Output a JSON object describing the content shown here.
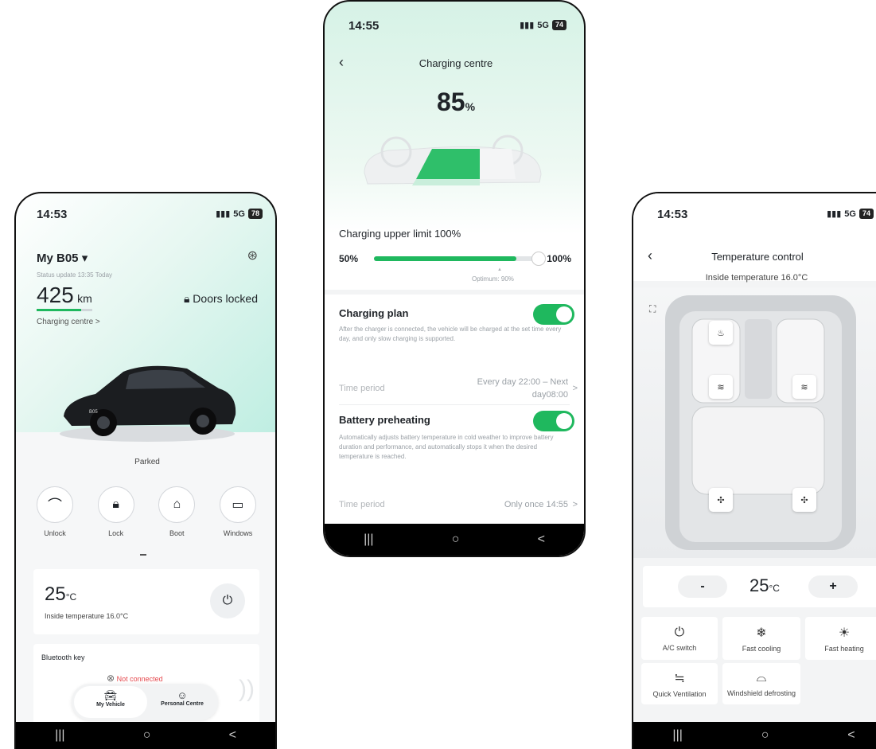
{
  "status_bars": {
    "left": {
      "time": "14:53",
      "signal": "5G",
      "battery": "78"
    },
    "center": {
      "time": "14:55",
      "signal": "5G",
      "battery": "74"
    },
    "right": {
      "time": "14:53",
      "signal": "5G",
      "battery": "74"
    }
  },
  "navbar": {
    "recent": "|||",
    "home": "○",
    "back": "<"
  },
  "vehicle": {
    "title": "My B05 ▾",
    "status_update": "Status update 13:35 Today",
    "range_value": "425",
    "range_unit": "km",
    "doors_status": "Doors locked",
    "charging_link": "Charging centre >",
    "car_state": "Parked",
    "car_badge": "B05",
    "actions": [
      {
        "label": "Unlock",
        "icon": "unlock-icon"
      },
      {
        "label": "Lock",
        "icon": "lock-icon"
      },
      {
        "label": "Boot",
        "icon": "car-boot-icon"
      },
      {
        "label": "Windows",
        "icon": "window-icon"
      }
    ],
    "climate": {
      "temp": "25",
      "unit": "°C",
      "inside": "Inside temperature 16.0°C"
    },
    "bluetooth": {
      "title": "Bluetooth key",
      "status": "Not connected"
    },
    "tabs": [
      {
        "label": "My Vehicle"
      },
      {
        "label": "Personal Centre"
      }
    ]
  },
  "charging": {
    "title": "Charging centre",
    "percent": "85",
    "percent_unit": "%",
    "upper_limit_label": "Charging upper limit 100%",
    "slider_min": "50%",
    "slider_max": "100%",
    "slider_fill": 0.85,
    "optimum": "Optimum: 90%",
    "plan_title": "Charging plan",
    "plan_desc": "After the charger is connected, the vehicle will be charged at the set time every day, and only slow charging is supported.",
    "plan_time_label": "Time period",
    "plan_time_value_1": "Every day 22:00 – Next",
    "plan_time_value_2": "day08:00",
    "preheat_title": "Battery preheating",
    "preheat_desc": "Automatically adjusts battery temperature in cold weather to improve battery duration and performance, and automatically stops it when the desired temperature is reached.",
    "preheat_time_label": "Time period",
    "preheat_time_value": "Only once 14:55",
    "chevron": ">"
  },
  "temperature": {
    "title": "Temperature control",
    "inside": "Inside temperature 16.0°C",
    "minus": "-",
    "plus": "+",
    "temp": "25",
    "unit": "°C",
    "tiles": [
      {
        "label": "A/C switch",
        "icon": "ac-power-icon"
      },
      {
        "label": "Fast cooling",
        "icon": "snowflake-icon"
      },
      {
        "label": "Fast heating",
        "icon": "sun-icon"
      },
      {
        "label": "Quick Ventilation",
        "icon": "wind-icon"
      },
      {
        "label": "Windshield defrosting",
        "icon": "defrost-icon"
      }
    ]
  },
  "colors": {
    "accent_green": "#1fb85e",
    "alert_red": "#e5484d"
  }
}
